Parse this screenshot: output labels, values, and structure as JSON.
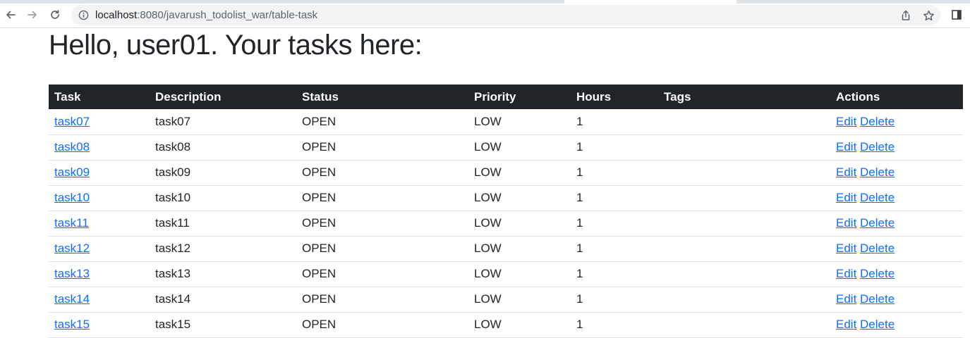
{
  "browser": {
    "url_host": "localhost",
    "url_rest": ":8080/javarush_todolist_war/table-task"
  },
  "page": {
    "heading": "Hello, user01. Your tasks here:"
  },
  "table": {
    "headers": {
      "task": "Task",
      "description": "Description",
      "status": "Status",
      "priority": "Priority",
      "hours": "Hours",
      "tags": "Tags",
      "actions": "Actions"
    },
    "edit_label": "Edit",
    "delete_label": "Delete",
    "rows": [
      {
        "task": "task07",
        "description": "task07",
        "status": "OPEN",
        "priority": "LOW",
        "hours": "1",
        "tags": ""
      },
      {
        "task": "task08",
        "description": "task08",
        "status": "OPEN",
        "priority": "LOW",
        "hours": "1",
        "tags": ""
      },
      {
        "task": "task09",
        "description": "task09",
        "status": "OPEN",
        "priority": "LOW",
        "hours": "1",
        "tags": ""
      },
      {
        "task": "task10",
        "description": "task10",
        "status": "OPEN",
        "priority": "LOW",
        "hours": "1",
        "tags": ""
      },
      {
        "task": "task11",
        "description": "task11",
        "status": "OPEN",
        "priority": "LOW",
        "hours": "1",
        "tags": ""
      },
      {
        "task": "task12",
        "description": "task12",
        "status": "OPEN",
        "priority": "LOW",
        "hours": "1",
        "tags": ""
      },
      {
        "task": "task13",
        "description": "task13",
        "status": "OPEN",
        "priority": "LOW",
        "hours": "1",
        "tags": ""
      },
      {
        "task": "task14",
        "description": "task14",
        "status": "OPEN",
        "priority": "LOW",
        "hours": "1",
        "tags": ""
      },
      {
        "task": "task15",
        "description": "task15",
        "status": "OPEN",
        "priority": "LOW",
        "hours": "1",
        "tags": ""
      }
    ]
  },
  "colors": {
    "header_bg": "#212529",
    "link": "#0d6efd",
    "row_border": "#dee2e6"
  },
  "icons": {
    "back": "back-arrow-icon",
    "forward": "forward-arrow-icon",
    "reload": "reload-icon",
    "site_info": "info-icon",
    "share": "share-icon",
    "bookmark": "star-icon",
    "side_panel": "side-panel-icon"
  }
}
